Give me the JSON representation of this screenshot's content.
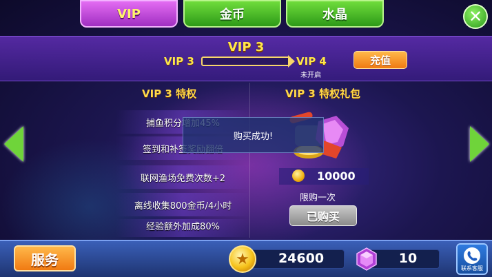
{
  "tabs": [
    {
      "label": "VIP",
      "active": true
    },
    {
      "label": "金币",
      "active": false
    },
    {
      "label": "水晶",
      "active": false
    }
  ],
  "header": {
    "title": "VIP 3",
    "current_level": "VIP 3",
    "next_level": "VIP 4",
    "next_level_status": "未开启",
    "progress_fraction": 0.0,
    "recharge_label": "充值"
  },
  "privileges": {
    "title": "VIP 3 特权",
    "items": [
      "捕鱼积分增加45%",
      "签到和补签奖励翻倍",
      "联网渔场免费次数+2",
      "离线收集800金币/4小时",
      "经验额外加成80%"
    ]
  },
  "gift": {
    "title": "VIP 3 特权礼包",
    "price": "10000",
    "limit_text": "限购一次",
    "button_label": "已购买"
  },
  "toast": {
    "message": "购买成功!"
  },
  "bottom": {
    "service_label": "服务",
    "coins": "24600",
    "gems": "10",
    "support_label": "联系客服"
  },
  "colors": {
    "accent_gold": "#ffe74a",
    "tab_active": "#c44fe0",
    "tab_inactive": "#3fb025",
    "button_orange": "#f59028"
  }
}
